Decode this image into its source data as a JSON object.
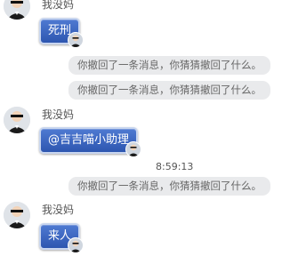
{
  "chat": {
    "sender_name": "我没妈",
    "messages": [
      {
        "type": "user",
        "text": "死刑"
      },
      {
        "type": "system",
        "text": "你撤回了一条消息，你猜猜撤回了什么。"
      },
      {
        "type": "system",
        "text": "你撤回了一条消息，你猜猜撤回了什么。"
      },
      {
        "type": "user",
        "text": "@吉吉喵小助理"
      },
      {
        "type": "timestamp",
        "text": "8:59:13"
      },
      {
        "type": "system",
        "text": "你撤回了一条消息，你猜猜撤回了什么。"
      },
      {
        "type": "user",
        "text": "来人"
      }
    ]
  },
  "icons": {
    "avatar": "person-avatar-icon",
    "bubble_decoration": "mini-avatar-icon"
  },
  "colors": {
    "bubble_top": "#4f7ad2",
    "bubble_bottom": "#2d56b0",
    "system_bg": "#e9eaec"
  }
}
